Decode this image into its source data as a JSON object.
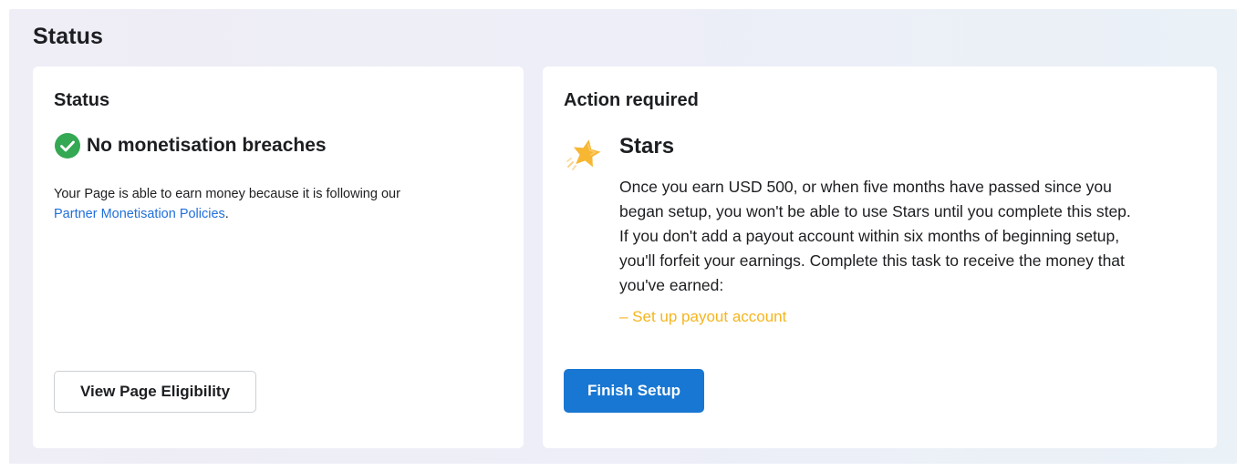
{
  "section": {
    "title": "Status"
  },
  "status_card": {
    "title": "Status",
    "status_icon": "check-circle-icon",
    "status_text": "No monetisation breaches",
    "description": "Your Page is able to earn money because it is following our",
    "policy_link": "Partner Monetisation Policies",
    "description_end": ".",
    "button_label": "View Page Eligibility"
  },
  "action_card": {
    "title": "Action required",
    "item_icon": "star-icon",
    "item_title": "Stars",
    "item_body": "Once you earn USD 500, or when five months have passed since you began setup, you won't be able to use Stars until you complete this step. If you don't add a payout account within six months of beginning setup, you'll forfeit your earnings. Complete this task to receive the money that you've earned:",
    "task_link": "– Set up payout account",
    "button_label": "Finish Setup"
  },
  "colors": {
    "success": "#34a853",
    "link": "#216fdb",
    "task_link": "#f6b51e",
    "primary_button": "#1877d2",
    "star": "#f7b733"
  }
}
